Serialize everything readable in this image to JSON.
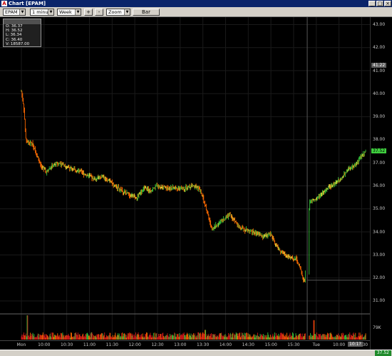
{
  "window": {
    "title": "Chart [EPAM]",
    "app_icon": "app-logo-icon",
    "controls": [
      "minimize-icon",
      "maximize-icon",
      "close-icon"
    ]
  },
  "toolbar": {
    "symbol": "EPAM",
    "interval": "1 minute",
    "period": "Week",
    "zoom_in_label": "+",
    "zoom_out_label": "-",
    "zoom_mode": "Zoom",
    "chart_type_label": "Bar"
  },
  "info_box": {
    "header": "",
    "open": "O: 36.37",
    "high": "H: 36.52",
    "low": "L: 36.34",
    "close": "C: 36.40",
    "volume": "V: 18587.00"
  },
  "status": {
    "last_price": "37.52"
  },
  "colors": {
    "up": "#36c43a",
    "down": "#ff6a00",
    "neutral": "#e8d838",
    "volume": "#d21a1a",
    "current_tag": "#3fcf3f",
    "background": "#000000"
  },
  "chart_data": {
    "type": "bar",
    "title": "",
    "xlabel": "",
    "ylabel": "",
    "ylim": [
      30.5,
      43.2
    ],
    "y_ticks": [
      "43.00",
      "42.00",
      "41.00",
      "40.00",
      "39.00",
      "38.00",
      "37.00",
      "36.00",
      "35.00",
      "34.00",
      "33.00",
      "32.00",
      "31.00"
    ],
    "volume_label": "79K",
    "crosshair_price": "41.22",
    "current_price": "37.52",
    "current_time": "10:1?",
    "x_ticks": [
      {
        "label": "Mon",
        "t": 0.0
      },
      {
        "label": "10:00",
        "t": 0.5
      },
      {
        "label": "10:30",
        "t": 1.0
      },
      {
        "label": "11:00",
        "t": 1.5
      },
      {
        "label": "11:30",
        "t": 2.0
      },
      {
        "label": "12:00",
        "t": 2.5
      },
      {
        "label": "12:30",
        "t": 3.0
      },
      {
        "label": "13:00",
        "t": 3.5
      },
      {
        "label": "13:30",
        "t": 4.0
      },
      {
        "label": "14:00",
        "t": 4.5
      },
      {
        "label": "14:30",
        "t": 5.0
      },
      {
        "label": "15:00",
        "t": 5.5
      },
      {
        "label": "15:30",
        "t": 6.0
      },
      {
        "label": "Tue",
        "t": 6.5
      },
      {
        "label": "10:00",
        "t": 7.0
      },
      {
        "label": "10:30",
        "t": 7.5
      }
    ],
    "price_path": [
      [
        0.0,
        40.1
      ],
      [
        0.05,
        39.5
      ],
      [
        0.1,
        38.0
      ],
      [
        0.15,
        37.9
      ],
      [
        0.25,
        37.8
      ],
      [
        0.35,
        37.3
      ],
      [
        0.45,
        36.8
      ],
      [
        0.55,
        36.6
      ],
      [
        0.7,
        36.9
      ],
      [
        0.85,
        37.0
      ],
      [
        1.0,
        36.8
      ],
      [
        1.2,
        36.7
      ],
      [
        1.4,
        36.5
      ],
      [
        1.6,
        36.3
      ],
      [
        1.8,
        36.4
      ],
      [
        2.0,
        36.1
      ],
      [
        2.2,
        35.8
      ],
      [
        2.4,
        35.6
      ],
      [
        2.55,
        35.5
      ],
      [
        2.7,
        35.9
      ],
      [
        2.85,
        35.8
      ],
      [
        3.0,
        36.0
      ],
      [
        3.2,
        35.9
      ],
      [
        3.4,
        35.9
      ],
      [
        3.6,
        35.9
      ],
      [
        3.8,
        36.0
      ],
      [
        3.95,
        35.8
      ],
      [
        4.1,
        34.8
      ],
      [
        4.2,
        34.1
      ],
      [
        4.35,
        34.4
      ],
      [
        4.5,
        34.6
      ],
      [
        4.6,
        34.8
      ],
      [
        4.75,
        34.3
      ],
      [
        4.9,
        34.1
      ],
      [
        5.1,
        34.0
      ],
      [
        5.3,
        33.8
      ],
      [
        5.5,
        33.9
      ],
      [
        5.6,
        33.4
      ],
      [
        5.75,
        33.1
      ],
      [
        5.9,
        32.9
      ],
      [
        6.0,
        32.8
      ],
      [
        6.05,
        32.9
      ],
      [
        6.15,
        32.4
      ],
      [
        6.2,
        32.0
      ],
      [
        6.25,
        31.9
      ],
      [
        6.35,
        35.3
      ],
      [
        6.45,
        35.4
      ],
      [
        6.6,
        35.6
      ],
      [
        6.75,
        35.9
      ],
      [
        6.9,
        36.1
      ],
      [
        7.05,
        36.3
      ],
      [
        7.2,
        36.7
      ],
      [
        7.35,
        36.9
      ],
      [
        7.5,
        37.3
      ],
      [
        7.6,
        37.52
      ]
    ],
    "volume_spikes": [
      {
        "t": 0.13,
        "v": 1.0
      },
      {
        "t": 6.3,
        "v": 0.55
      },
      {
        "t": 6.45,
        "v": 0.8
      },
      {
        "t": 4.05,
        "v": 0.4
      },
      {
        "t": 1.55,
        "v": 0.3
      },
      {
        "t": 3.9,
        "v": 0.3
      }
    ]
  }
}
